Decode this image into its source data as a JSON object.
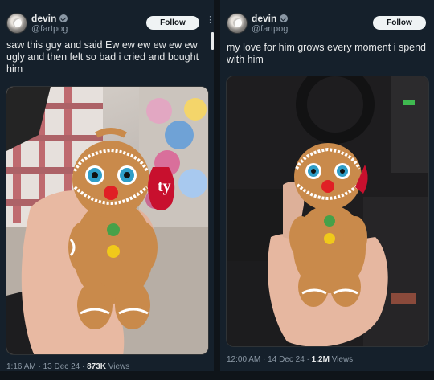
{
  "tweets": [
    {
      "author": {
        "name": "devin",
        "handle": "@fartpog"
      },
      "follow_label": "Follow",
      "more_label": "⋮",
      "text": "saw this guy and said Ew ew ew ew ew ew ugly and then felt so bad i cried and bought him",
      "time": "1:16 AM",
      "date": "13 Dec 24",
      "views_count": "873K",
      "views_label": "Views",
      "tag_text": "ty"
    },
    {
      "author": {
        "name": "devin",
        "handle": "@fartpog"
      },
      "follow_label": "Follow",
      "more_label": "⋮",
      "text": "my love for him grows every moment i spend with him",
      "time": "12:00 AM",
      "date": "14 Dec 24",
      "views_count": "1.2M",
      "views_label": "Views"
    }
  ],
  "separator": "·",
  "colors": {
    "background": "#15202b",
    "text": "#e7e9ea",
    "secondary": "#8b98a5",
    "follow_bg": "#eff3f4",
    "ginger": "#c98a4b",
    "ty_tag": "#c8102e"
  }
}
